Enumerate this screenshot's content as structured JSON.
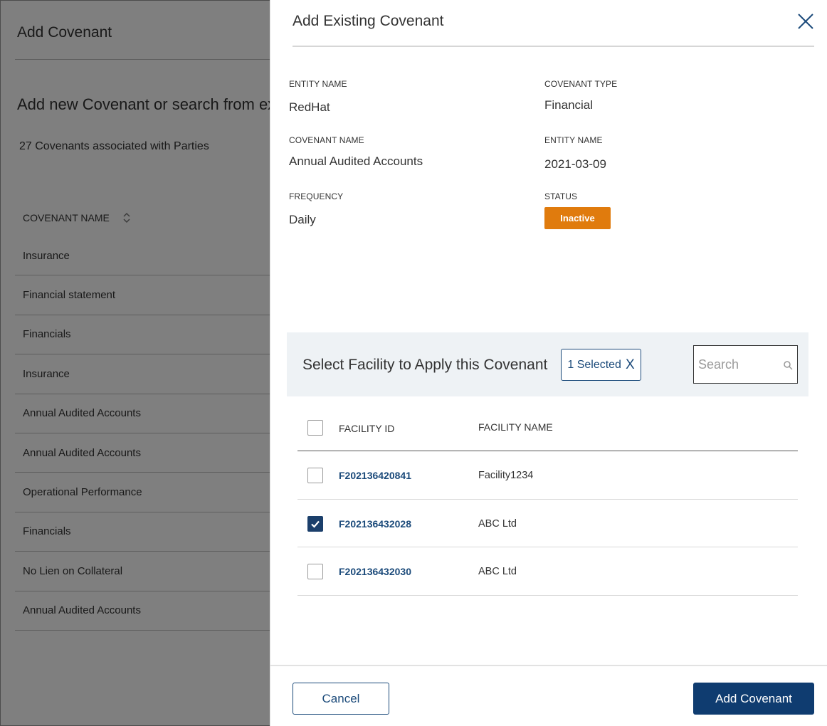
{
  "background": {
    "title": "Add Covenant",
    "heading": "Add new Covenant or search from ex",
    "count": "27 Covenants associated with Parties",
    "column_header": "COVENANT NAME",
    "rows": [
      "Insurance",
      "Financial statement",
      "Financials",
      "Insurance",
      "Annual Audited Accounts",
      "Annual Audited Accounts",
      "Operational Performance",
      "Financials",
      "No Lien on Collateral",
      "Annual Audited Accounts"
    ]
  },
  "drawer": {
    "title": "Add Existing Covenant",
    "details": {
      "entity_name_label": "ENTITY NAME",
      "entity_name_value": "RedHat",
      "covenant_type_label": "COVENANT TYPE",
      "covenant_type_value": "Financial",
      "covenant_name_label": "COVENANT NAME",
      "covenant_name_value": "Annual Audited Accounts",
      "entity_name2_label": "ENTITY NAME",
      "entity_name2_value": "2021-03-09",
      "frequency_label": "FREQUENCY",
      "frequency_value": "Daily",
      "status_label": "STATUS",
      "status_value": "Inactive"
    },
    "facility": {
      "title": "Select Facility to Apply this Covenant",
      "selected_label": "1 Selected",
      "selected_clear": "X",
      "search_placeholder": "Search",
      "columns": {
        "id": "FACILITY ID",
        "name": "FACILITY NAME"
      },
      "rows": [
        {
          "id": "F202136420841",
          "name": "Facility1234",
          "checked": false
        },
        {
          "id": "F202136432028",
          "name": "ABC Ltd",
          "checked": true
        },
        {
          "id": "F202136432030",
          "name": "ABC Ltd",
          "checked": false
        }
      ]
    },
    "footer": {
      "cancel_label": "Cancel",
      "add_label": "Add Covenant"
    }
  },
  "colors": {
    "primary": "#0f3c70",
    "link": "#1b4a7a",
    "status_inactive": "#e07b0d",
    "band_bg": "#eef2f5"
  }
}
